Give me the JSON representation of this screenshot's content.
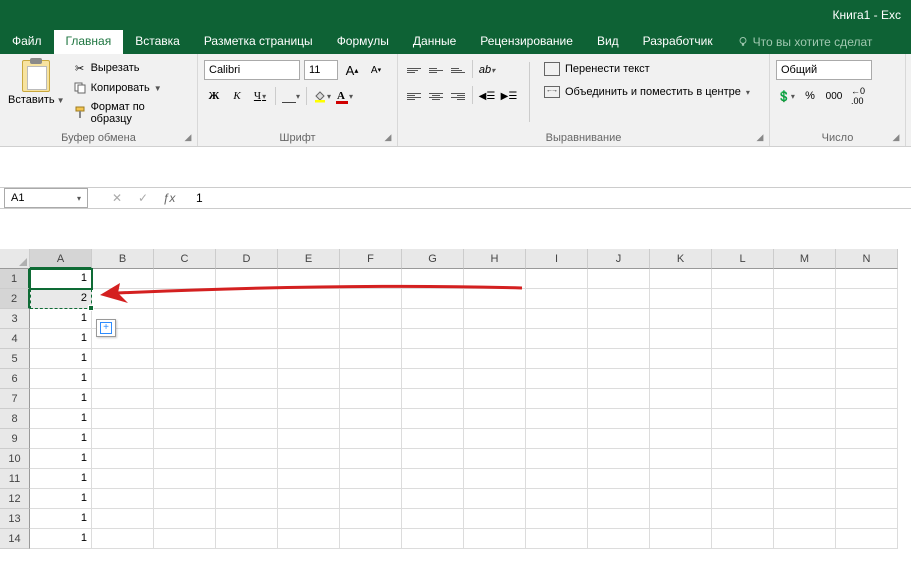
{
  "title": "Книга1 - Exc",
  "tabs": {
    "file": "Файл",
    "home": "Главная",
    "insert": "Вставка",
    "pagelayout": "Разметка страницы",
    "formulas": "Формулы",
    "data": "Данные",
    "review": "Рецензирование",
    "view": "Вид",
    "developer": "Разработчик",
    "tell": "Что вы хотите сделат"
  },
  "clipboard": {
    "paste": "Вставить",
    "cut": "Вырезать",
    "copy": "Копировать",
    "painter": "Формат по образцу",
    "group": "Буфер обмена"
  },
  "font": {
    "name": "Calibri",
    "size": "11",
    "group": "Шрифт"
  },
  "alignment": {
    "wrap": "Перенести текст",
    "merge": "Объединить и поместить в центре",
    "group": "Выравнивание"
  },
  "number": {
    "format": "Общий",
    "group": "Число"
  },
  "namebox": "A1",
  "formula": "1",
  "columns": [
    "A",
    "B",
    "C",
    "D",
    "E",
    "F",
    "G",
    "H",
    "I",
    "J",
    "K",
    "L",
    "M",
    "N"
  ],
  "rows": [
    {
      "n": 1,
      "A": "1"
    },
    {
      "n": 2,
      "A": "2"
    },
    {
      "n": 3,
      "A": "1"
    },
    {
      "n": 4,
      "A": "1"
    },
    {
      "n": 5,
      "A": "1"
    },
    {
      "n": 6,
      "A": "1"
    },
    {
      "n": 7,
      "A": "1"
    },
    {
      "n": 8,
      "A": "1"
    },
    {
      "n": 9,
      "A": "1"
    },
    {
      "n": 10,
      "A": "1"
    },
    {
      "n": 11,
      "A": "1"
    },
    {
      "n": 12,
      "A": "1"
    },
    {
      "n": 13,
      "A": "1"
    },
    {
      "n": 14,
      "A": "1"
    }
  ]
}
